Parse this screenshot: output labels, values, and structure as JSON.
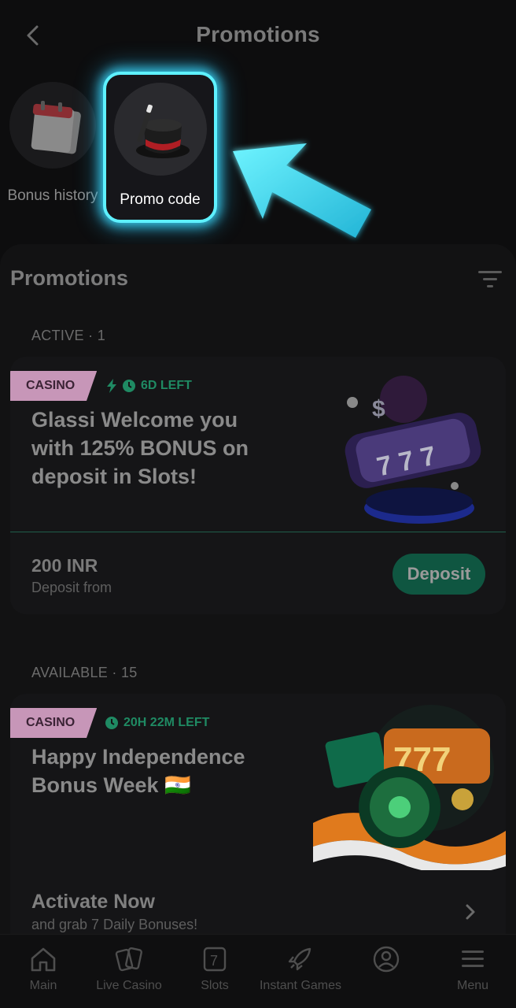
{
  "header": {
    "title": "Promotions",
    "back_icon": "chevron-left-icon"
  },
  "shortcuts": [
    {
      "label": "Bonus history",
      "icon": "calendar-icon"
    },
    {
      "label": "Promo code",
      "icon": "magic-hat-icon"
    }
  ],
  "promotions": {
    "title": "Promotions",
    "filter_icon": "filter-icon",
    "active_label": "ACTIVE · 1",
    "available_label": "AVAILABLE · 15",
    "active_card": {
      "badge": "CASINO",
      "timer": "6D LEFT",
      "title_lines": [
        "Glassi Welcome you",
        "with 125% BONUS on",
        "deposit in Slots!"
      ],
      "amount": "200 INR",
      "amount_sub": "Deposit from",
      "button": "Deposit",
      "image_icon": "slot-machine-icon"
    },
    "available_card": {
      "badge": "CASINO",
      "timer": "20H 22M LEFT",
      "title_lines": [
        "Happy Independence",
        "Bonus Week 🇮🇳"
      ],
      "cta_title": "Activate Now",
      "cta_sub": "and grab 7 Daily Bonuses!",
      "image_icon": "roulette-slots-icon"
    }
  },
  "bottom_nav": [
    {
      "label": "Main",
      "icon": "home-icon"
    },
    {
      "label": "Live Casino",
      "icon": "cards-icon"
    },
    {
      "label": "Slots",
      "icon": "slot-seven-icon"
    },
    {
      "label": "Instant Games",
      "icon": "rocket-icon"
    },
    {
      "label": "",
      "icon": "profile-icon"
    },
    {
      "label": "Menu",
      "icon": "menu-icon"
    }
  ],
  "colors": {
    "accent_green": "#1f8a63",
    "badge_pink": "#c796b8",
    "highlight_cyan": "#5ef1ff"
  }
}
